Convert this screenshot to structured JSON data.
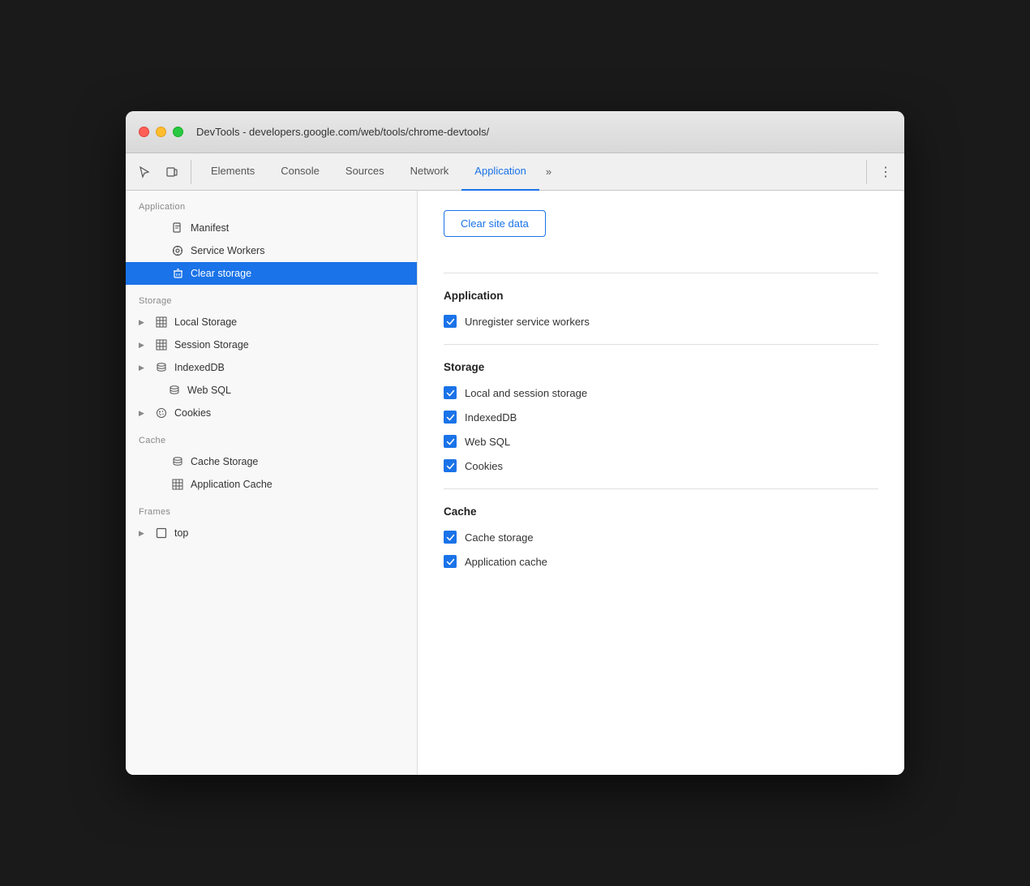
{
  "window": {
    "title": "DevTools - developers.google.com/web/tools/chrome-devtools/"
  },
  "toolbar": {
    "tabs": [
      "Elements",
      "Console",
      "Sources",
      "Network",
      "Application"
    ],
    "active_tab": "Application",
    "more_label": "»",
    "menu_icon": "⋮"
  },
  "sidebar": {
    "section_application": "Application",
    "items_application": [
      {
        "id": "manifest",
        "label": "Manifest",
        "icon": "file",
        "active": false,
        "indent": "indented"
      },
      {
        "id": "service-workers",
        "label": "Service Workers",
        "icon": "gear",
        "active": false,
        "indent": "indented"
      },
      {
        "id": "clear-storage",
        "label": "Clear storage",
        "icon": "trash",
        "active": true,
        "indent": "indented"
      }
    ],
    "section_storage": "Storage",
    "items_storage": [
      {
        "id": "local-storage",
        "label": "Local Storage",
        "icon": "grid",
        "active": false,
        "has_arrow": true
      },
      {
        "id": "session-storage",
        "label": "Session Storage",
        "icon": "grid",
        "active": false,
        "has_arrow": true
      },
      {
        "id": "indexeddb",
        "label": "IndexedDB",
        "icon": "db",
        "active": false,
        "has_arrow": true
      },
      {
        "id": "web-sql",
        "label": "Web SQL",
        "icon": "db",
        "active": false,
        "has_arrow": false
      },
      {
        "id": "cookies",
        "label": "Cookies",
        "icon": "cookie",
        "active": false,
        "has_arrow": true
      }
    ],
    "section_cache": "Cache",
    "items_cache": [
      {
        "id": "cache-storage",
        "label": "Cache Storage",
        "icon": "db",
        "active": false,
        "indent": "indented"
      },
      {
        "id": "application-cache",
        "label": "Application Cache",
        "icon": "grid",
        "active": false,
        "indent": "indented"
      }
    ],
    "section_frames": "Frames",
    "items_frames": [
      {
        "id": "top",
        "label": "top",
        "icon": "frame",
        "active": false,
        "has_arrow": true
      }
    ]
  },
  "main": {
    "clear_button": "Clear site data",
    "section_application": {
      "title": "Application",
      "checkboxes": [
        {
          "id": "unregister-sw",
          "label": "Unregister service workers",
          "checked": true
        }
      ]
    },
    "section_storage": {
      "title": "Storage",
      "checkboxes": [
        {
          "id": "local-session",
          "label": "Local and session storage",
          "checked": true
        },
        {
          "id": "indexeddb",
          "label": "IndexedDB",
          "checked": true
        },
        {
          "id": "web-sql",
          "label": "Web SQL",
          "checked": true
        },
        {
          "id": "cookies",
          "label": "Cookies",
          "checked": true
        }
      ]
    },
    "section_cache": {
      "title": "Cache",
      "checkboxes": [
        {
          "id": "cache-storage",
          "label": "Cache storage",
          "checked": true
        },
        {
          "id": "app-cache",
          "label": "Application cache",
          "checked": true
        }
      ]
    }
  }
}
